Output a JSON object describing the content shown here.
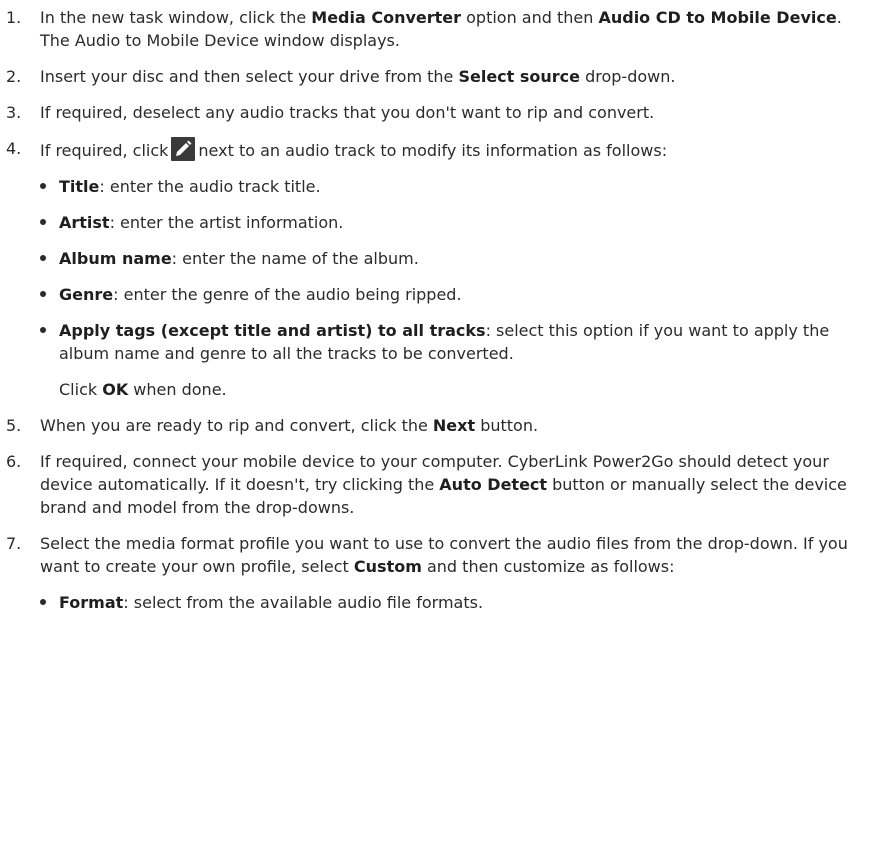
{
  "steps": [
    {
      "num": "1.",
      "pre": "In the new task window, click the ",
      "b1": "Media Converter",
      "mid": " option and then ",
      "b2": "Audio CD to Mobile Device",
      "post": ". The Audio to Mobile Device window displays."
    },
    {
      "num": "2.",
      "pre": "Insert your disc and then select your drive from the ",
      "b1": "Select source",
      "post": " drop-down."
    },
    {
      "num": "3.",
      "text": "If required, deselect any audio tracks that you don't want to rip and convert."
    },
    {
      "num": "4.",
      "pre": "If required, click",
      "icon": "pencil-icon",
      "post": "next to an audio track to modify its information as follows:"
    },
    {
      "num": "5.",
      "pre": "When you are ready to rip and convert, click the ",
      "b1": "Next",
      "post": " button."
    },
    {
      "num": "6.",
      "pre": "If required, connect your mobile device to your computer. CyberLink Power2Go should detect your device automatically. If it doesn't, try clicking the ",
      "b1": "Auto Detect",
      "post": " button or manually select the device brand and model from the drop-downs."
    },
    {
      "num": "7.",
      "pre": "Select the media format profile you want to use to convert the audio files from the drop-down. If you want to create your own profile, select ",
      "b1": "Custom",
      "post": " and then customize as follows:"
    }
  ],
  "step4_bullets": [
    {
      "label": "Title",
      "text": ": enter the audio track title."
    },
    {
      "label": "Artist",
      "text": ": enter the artist information."
    },
    {
      "label": "Album name",
      "text": ": enter the name of the album."
    },
    {
      "label": "Genre",
      "text": ": enter the genre of the audio being ripped."
    },
    {
      "label": "Apply tags (except title and artist) to all tracks",
      "text": ": select this option if you want to apply the album name and genre to all the tracks to be converted."
    }
  ],
  "step4_note": {
    "pre": "Click ",
    "b1": "OK",
    "post": " when done."
  },
  "step7_bullets": [
    {
      "label": "Format",
      "text": ": select from the available audio file formats."
    }
  ],
  "colors": {
    "text": "#2b2b2b",
    "icon_bg": "#3a3a3a",
    "icon_fg": "#ffffff"
  }
}
